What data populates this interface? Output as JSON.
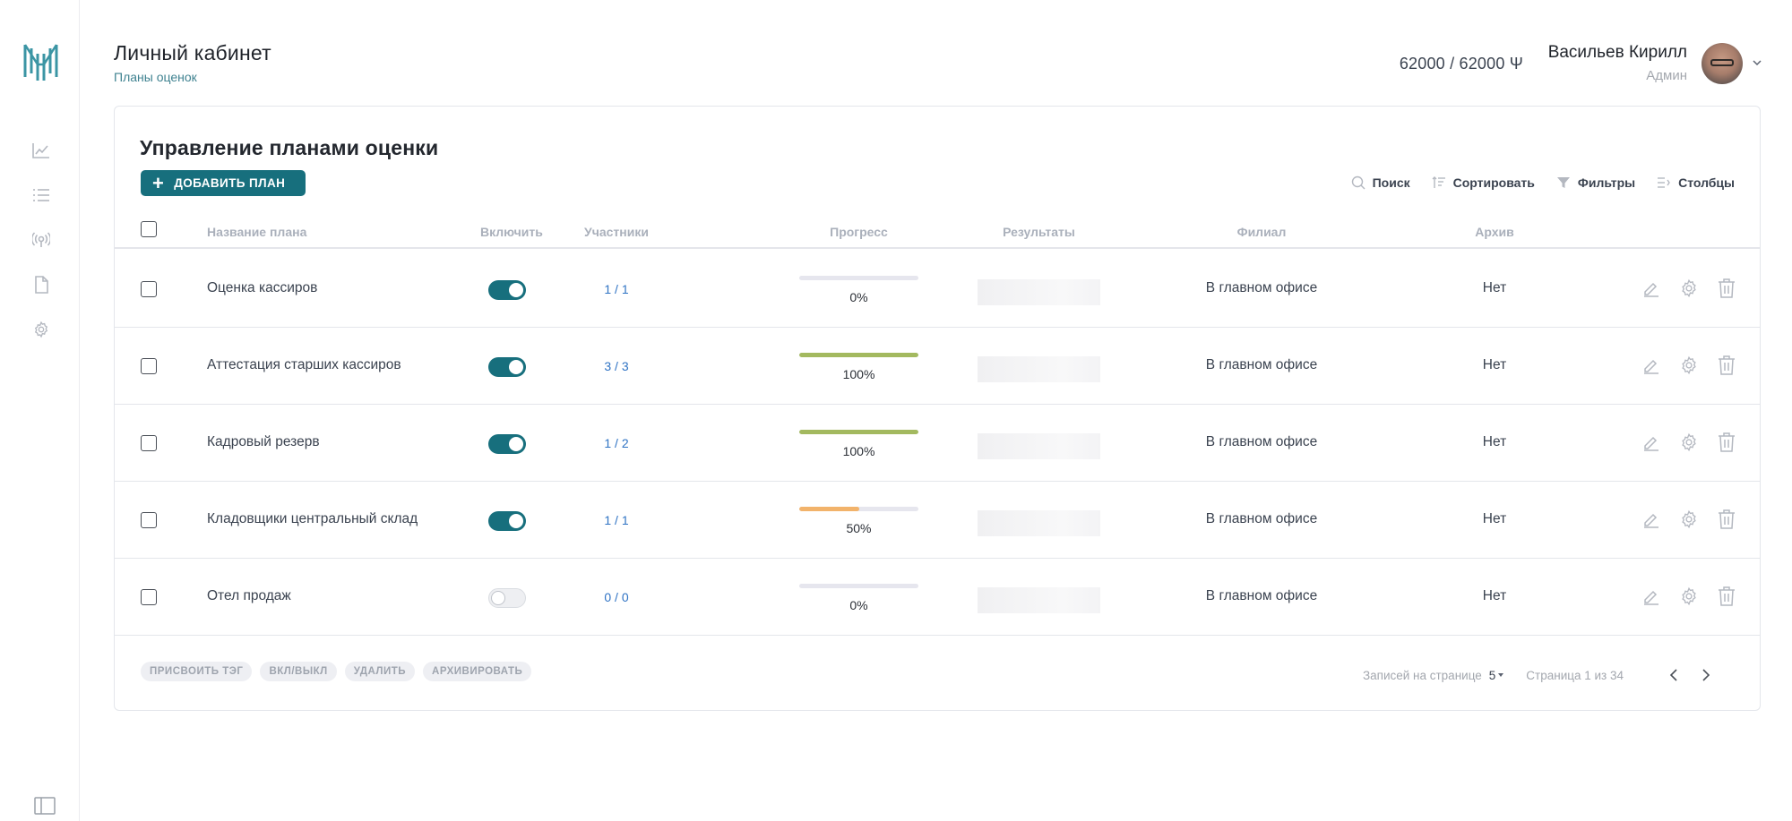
{
  "header": {
    "title": "Личный кабинет",
    "breadcrumb": "Планы оценок",
    "balance": "62000 / 62000 Ψ",
    "user_name": "Васильев Кирилл",
    "user_role": "Админ"
  },
  "sidebar": {
    "items": [
      {
        "icon": "chart-line-icon"
      },
      {
        "icon": "list-icon"
      },
      {
        "icon": "broadcast-icon"
      },
      {
        "icon": "document-icon"
      },
      {
        "icon": "gear-icon"
      }
    ]
  },
  "card": {
    "title": "Управление планами оценки",
    "add_button": "ДОБАВИТЬ ПЛАН",
    "toolbar": {
      "search": "Поиск",
      "sort": "Сортировать",
      "filters": "Фильтры",
      "columns": "Столбцы"
    }
  },
  "table": {
    "columns": {
      "name": "Название плана",
      "enable": "Включить",
      "participants": "Участники",
      "progress": "Прогресс",
      "results": "Результаты",
      "branch": "Филиал",
      "archive": "Архив"
    },
    "rows": [
      {
        "name": "Оценка кассиров",
        "enabled": true,
        "participants": "1 / 1",
        "progress": 0,
        "progress_label": "0%",
        "branch": "В главном офисе",
        "archive": "Нет"
      },
      {
        "name": "Аттестация старших кассиров",
        "enabled": true,
        "participants": "3 / 3",
        "progress": 100,
        "progress_label": "100%",
        "branch": "В главном офисе",
        "archive": "Нет"
      },
      {
        "name": "Кадровый резерв",
        "enabled": true,
        "participants": "1 / 2",
        "progress": 100,
        "progress_label": "100%",
        "branch": "В главном офисе",
        "archive": "Нет"
      },
      {
        "name": "Кладовщики центральный склад",
        "enabled": true,
        "participants": "1 / 1",
        "progress": 50,
        "progress_label": "50%",
        "branch": "В главном офисе",
        "archive": "Нет"
      },
      {
        "name": "Отел продаж",
        "enabled": false,
        "participants": "0 / 0",
        "progress": 0,
        "progress_label": "0%",
        "branch": "В главном офисе",
        "archive": "Нет"
      }
    ]
  },
  "footer": {
    "bulk_actions": [
      "ПРИСВОИТЬ ТЭГ",
      "ВКЛ/ВЫКЛ",
      "УДАЛИТЬ",
      "АРХИВИРОВАТЬ"
    ],
    "per_page_label": "Записей на странице",
    "per_page_value": "5",
    "page_info": "Страница 1 из 34"
  },
  "colors": {
    "accent": "#176f7d",
    "progress_full": "#a3b95f",
    "progress_half": "#f2b36b",
    "link": "#2f73c4"
  }
}
